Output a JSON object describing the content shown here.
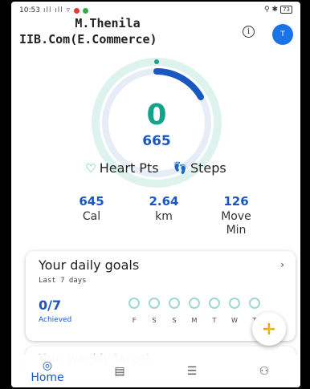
{
  "status_bar": {
    "time": "10:53",
    "battery": "73"
  },
  "overlay": {
    "line1": "M.Thenila",
    "line2": "IIB.Com(E.Commerce)"
  },
  "header": {
    "avatar_letter": "T",
    "info_icon": "info-icon"
  },
  "ring": {
    "heart_value": "0",
    "steps_value": "665",
    "heart_color": "#12a38a",
    "steps_color": "#1a57c2"
  },
  "legend": {
    "heart_label": "Heart Pts",
    "steps_label": "Steps"
  },
  "stats": [
    {
      "value": "645",
      "label": "Cal"
    },
    {
      "value": "2.64",
      "label": "km"
    },
    {
      "value": "126",
      "label": "Move Min"
    }
  ],
  "goals_card": {
    "title": "Your daily goals",
    "subtitle": "Last 7 days",
    "count": "0/7",
    "count_label": "Achieved",
    "days": [
      "F",
      "S",
      "S",
      "M",
      "T",
      "W",
      "T"
    ]
  },
  "next_card": {
    "title": "Your weekly target"
  },
  "nav": {
    "home_label": "Home"
  }
}
